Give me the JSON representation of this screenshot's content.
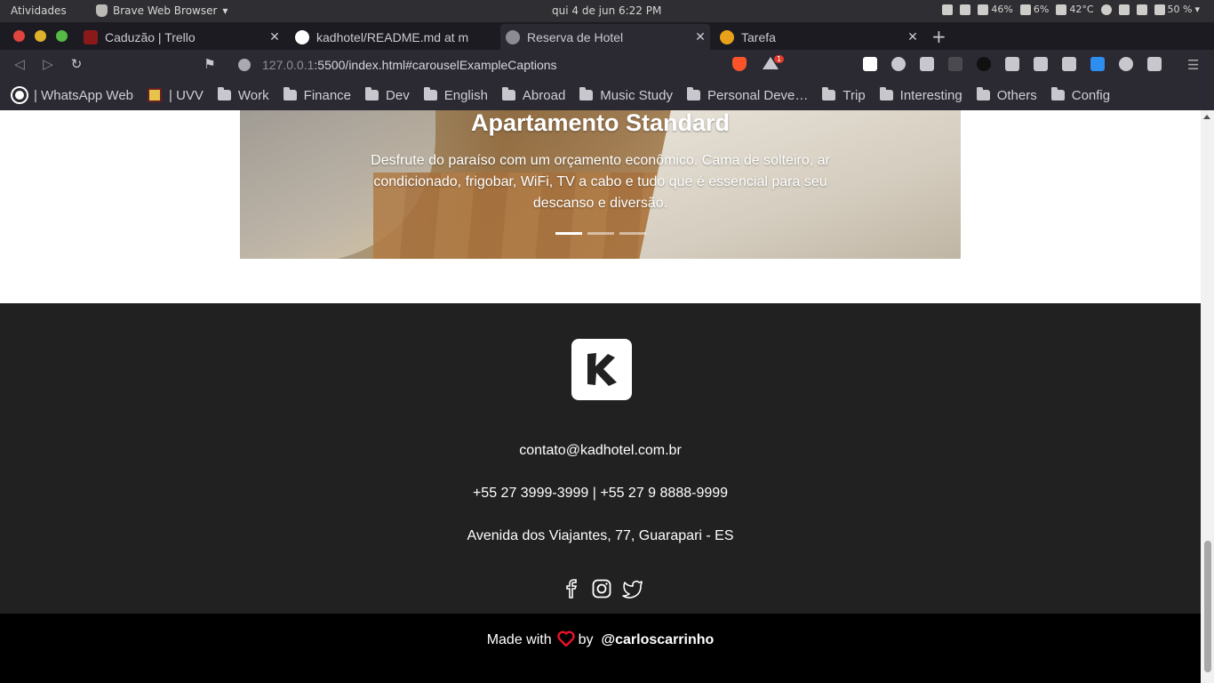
{
  "system_bar": {
    "activities": "Atividades",
    "app_name": "Brave Web Browser",
    "clock": "qui 4 de jun   6:22 PM",
    "battery": "46%",
    "cpu": "6%",
    "temperature": "42°C",
    "volume": "50 %"
  },
  "tabs": [
    {
      "title": "Caduzão | Trello",
      "favicon_color": "#8a1a1a"
    },
    {
      "title": "kadhotel/README.md at m",
      "favicon_color": "#ffffff"
    },
    {
      "title": "Reserva de Hotel",
      "favicon_color": "#8c8b93",
      "active": true
    },
    {
      "title": "Tarefa",
      "favicon_color": "#e9a11b"
    }
  ],
  "toolbar": {
    "url_host": "127.0.0.1",
    "url_rest": ":5500/index.html#carouselExampleCaptions",
    "notification_count": "1"
  },
  "bookmarks": [
    {
      "label": "| WhatsApp Web",
      "icon": "whatsapp-icon"
    },
    {
      "label": "| UVV",
      "icon": "uvv-icon"
    },
    {
      "label": "Work",
      "icon": "folder-icon"
    },
    {
      "label": "Finance",
      "icon": "folder-icon"
    },
    {
      "label": "Dev",
      "icon": "folder-icon"
    },
    {
      "label": "English",
      "icon": "folder-icon"
    },
    {
      "label": "Abroad",
      "icon": "folder-icon"
    },
    {
      "label": "Music Study",
      "icon": "folder-icon"
    },
    {
      "label": "Personal Deve…",
      "icon": "folder-icon"
    },
    {
      "label": "Trip",
      "icon": "folder-icon"
    },
    {
      "label": "Interesting",
      "icon": "folder-icon"
    },
    {
      "label": "Others",
      "icon": "folder-icon"
    },
    {
      "label": "Config",
      "icon": "folder-icon"
    }
  ],
  "carousel": {
    "title": "Apartamento Standard",
    "description": "Desfrute do paraíso com um orçamento econômico. Cama de solteiro, ar condicionado, frigobar, WiFi, TV a cabo e tudo que é essencial para seu descanso e diversão.",
    "slide_count": 3,
    "active_slide": 1
  },
  "footer": {
    "email": "contato@kadhotel.com.br",
    "phones": "+55 27 3999-3999 | +55 27 9 8888-9999",
    "address": "Avenida dos Viajantes, 77, Guarapari - ES",
    "socials": [
      "facebook-icon",
      "instagram-icon",
      "twitter-icon"
    ]
  },
  "credit": {
    "prefix": "Made with",
    "by": "by",
    "handle": "@carloscarrinho",
    "heart_color": "#e8132b"
  }
}
